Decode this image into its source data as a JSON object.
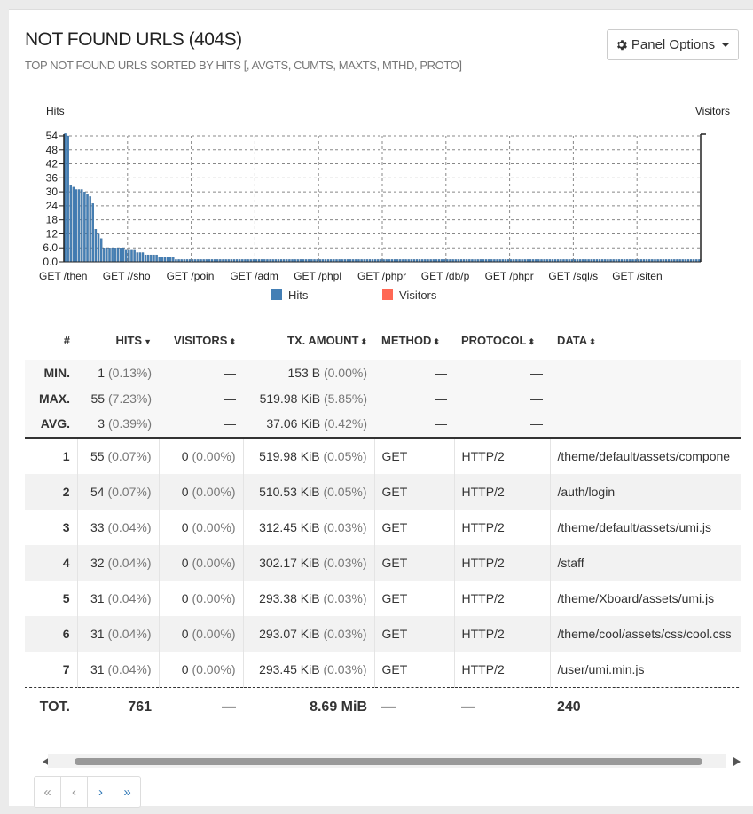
{
  "panel": {
    "title": "NOT FOUND URLS (404S)",
    "subtitle": "TOP NOT FOUND URLS SORTED BY HITS [, AVGTS, CUMTS, MAXTS, MTHD, PROTO]",
    "options_label": "Panel Options",
    "options_icon": "gear-icon"
  },
  "chart_data": {
    "type": "bar",
    "ylabel_left": "Hits",
    "ylabel_right": "Visitors",
    "y_ticks": [
      "54",
      "48",
      "42",
      "36",
      "30",
      "24",
      "18",
      "12",
      "6.0",
      "0.0"
    ],
    "ylim": [
      0,
      54
    ],
    "x_tick_labels": [
      "GET /then",
      "GET //sho",
      "GET /poin",
      "GET /adm",
      "GET /phpl",
      "GET /phpr",
      "GET /db/p",
      "GET /phpr",
      "GET /sql/s",
      "GET /siten"
    ],
    "legend": [
      "Hits",
      "Visitors"
    ],
    "colors": {
      "hits": "#447fb5",
      "visitors": "#ff6854"
    },
    "series": [
      {
        "name": "Hits",
        "values": [
          55,
          54,
          33,
          32,
          31,
          31,
          31,
          30,
          29,
          28,
          25,
          14,
          12,
          10,
          6,
          6,
          6,
          6,
          6,
          6,
          6,
          6,
          5,
          5,
          5,
          5,
          4,
          4,
          4,
          3,
          3,
          3,
          3,
          3,
          2,
          2,
          2,
          2,
          2,
          2,
          1,
          1,
          1,
          1,
          1,
          1,
          1,
          1,
          1,
          1,
          1,
          1,
          1,
          1,
          1,
          1,
          1,
          1,
          1,
          1,
          1,
          1,
          1,
          1,
          1,
          1,
          1,
          1,
          1,
          1,
          1,
          1,
          1,
          1,
          1,
          1,
          1,
          1,
          1,
          1,
          1,
          1,
          1,
          1,
          1,
          1,
          1,
          1,
          1,
          1,
          1,
          1,
          1,
          1,
          1,
          1,
          1,
          1,
          1,
          1,
          1,
          1,
          1,
          1,
          1,
          1,
          1,
          1,
          1,
          1,
          1,
          1,
          1,
          1,
          1,
          1,
          1,
          1,
          1,
          1,
          1,
          1,
          1,
          1,
          1,
          1,
          1,
          1,
          1,
          1,
          1,
          1,
          1,
          1,
          1,
          1,
          1,
          1,
          1,
          1,
          1,
          1,
          1,
          1,
          1,
          1,
          1,
          1,
          1,
          1,
          1,
          1,
          1,
          1,
          1,
          1,
          1,
          1,
          1,
          1,
          1,
          1,
          1,
          1,
          1,
          1,
          1,
          1,
          1,
          1,
          1,
          1,
          1,
          1,
          1,
          1,
          1,
          1,
          1,
          1,
          1,
          1,
          1,
          1,
          1,
          1,
          1,
          1,
          1,
          1,
          1,
          1,
          1,
          1,
          1,
          1,
          1,
          1,
          1,
          1,
          1,
          1,
          1,
          1,
          1,
          1,
          1,
          1,
          1,
          1,
          1,
          1,
          1,
          1,
          1,
          1,
          1,
          1,
          1,
          1,
          1,
          1,
          1,
          1,
          1,
          1,
          1,
          1,
          1,
          1
        ]
      },
      {
        "name": "Visitors",
        "values": []
      }
    ]
  },
  "table": {
    "headers": {
      "num": "#",
      "hits": "HITS",
      "visitors": "VISITORS",
      "tx": "TX. AMOUNT",
      "method": "METHOD",
      "protocol": "PROTOCOL",
      "data": "DATA"
    },
    "sort_desc_icon": "▼",
    "sort_both_icon": "⬍",
    "stats": [
      {
        "label": "MIN.",
        "hits": "1",
        "hits_pct": "(0.13%)",
        "visitors": "—",
        "tx": "153 B",
        "tx_pct": "(0.00%)",
        "method": "—",
        "protocol": "—"
      },
      {
        "label": "MAX.",
        "hits": "55",
        "hits_pct": "(7.23%)",
        "visitors": "—",
        "tx": "519.98 KiB",
        "tx_pct": "(5.85%)",
        "method": "—",
        "protocol": "—"
      },
      {
        "label": "AVG.",
        "hits": "3",
        "hits_pct": "(0.39%)",
        "visitors": "—",
        "tx": "37.06 KiB",
        "tx_pct": "(0.42%)",
        "method": "—",
        "protocol": "—"
      }
    ],
    "rows": [
      {
        "num": "1",
        "hits": "55",
        "hits_pct": "(0.07%)",
        "visitors": "0",
        "visitors_pct": "(0.00%)",
        "tx": "519.98 KiB",
        "tx_pct": "(0.05%)",
        "method": "GET",
        "protocol": "HTTP/2",
        "data": "/theme/default/assets/compone"
      },
      {
        "num": "2",
        "hits": "54",
        "hits_pct": "(0.07%)",
        "visitors": "0",
        "visitors_pct": "(0.00%)",
        "tx": "510.53 KiB",
        "tx_pct": "(0.05%)",
        "method": "GET",
        "protocol": "HTTP/2",
        "data": "/auth/login"
      },
      {
        "num": "3",
        "hits": "33",
        "hits_pct": "(0.04%)",
        "visitors": "0",
        "visitors_pct": "(0.00%)",
        "tx": "312.45 KiB",
        "tx_pct": "(0.03%)",
        "method": "GET",
        "protocol": "HTTP/2",
        "data": "/theme/default/assets/umi.js"
      },
      {
        "num": "4",
        "hits": "32",
        "hits_pct": "(0.04%)",
        "visitors": "0",
        "visitors_pct": "(0.00%)",
        "tx": "302.17 KiB",
        "tx_pct": "(0.03%)",
        "method": "GET",
        "protocol": "HTTP/2",
        "data": "/staff"
      },
      {
        "num": "5",
        "hits": "31",
        "hits_pct": "(0.04%)",
        "visitors": "0",
        "visitors_pct": "(0.00%)",
        "tx": "293.38 KiB",
        "tx_pct": "(0.03%)",
        "method": "GET",
        "protocol": "HTTP/2",
        "data": "/theme/Xboard/assets/umi.js"
      },
      {
        "num": "6",
        "hits": "31",
        "hits_pct": "(0.04%)",
        "visitors": "0",
        "visitors_pct": "(0.00%)",
        "tx": "293.07 KiB",
        "tx_pct": "(0.03%)",
        "method": "GET",
        "protocol": "HTTP/2",
        "data": "/theme/cool/assets/css/cool.css"
      },
      {
        "num": "7",
        "hits": "31",
        "hits_pct": "(0.04%)",
        "visitors": "0",
        "visitors_pct": "(0.00%)",
        "tx": "293.45 KiB",
        "tx_pct": "(0.03%)",
        "method": "GET",
        "protocol": "HTTP/2",
        "data": "/user/umi.min.js"
      }
    ],
    "total": {
      "label": "TOT.",
      "hits": "761",
      "visitors": "—",
      "tx": "8.69 MiB",
      "method": "—",
      "protocol": "—",
      "data": "240"
    }
  },
  "pagination": {
    "first": "«",
    "prev": "‹",
    "next": "›",
    "last": "»"
  }
}
